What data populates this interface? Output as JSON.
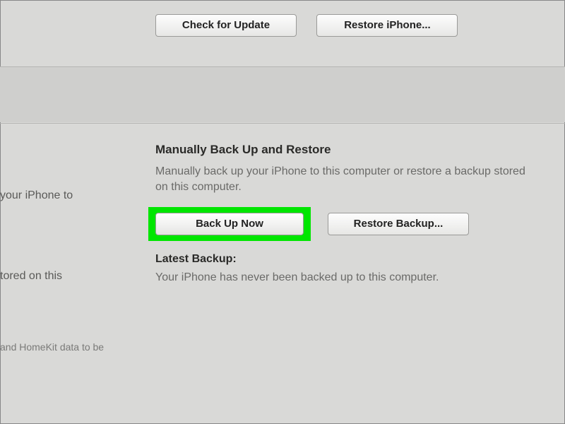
{
  "top": {
    "check_update_label": "Check for Update",
    "restore_iphone_label": "Restore iPhone..."
  },
  "left_fragments": {
    "frag1": "your iPhone to",
    "frag2": "tored on this",
    "frag3": "and HomeKit data to be"
  },
  "manual": {
    "heading": "Manually Back Up and Restore",
    "description": "Manually back up your iPhone to this computer or restore a backup stored on this computer.",
    "back_up_now_label": "Back Up Now",
    "restore_backup_label": "Restore Backup..."
  },
  "latest": {
    "heading": "Latest Backup:",
    "text": "Your iPhone has never been backed up to this computer."
  }
}
